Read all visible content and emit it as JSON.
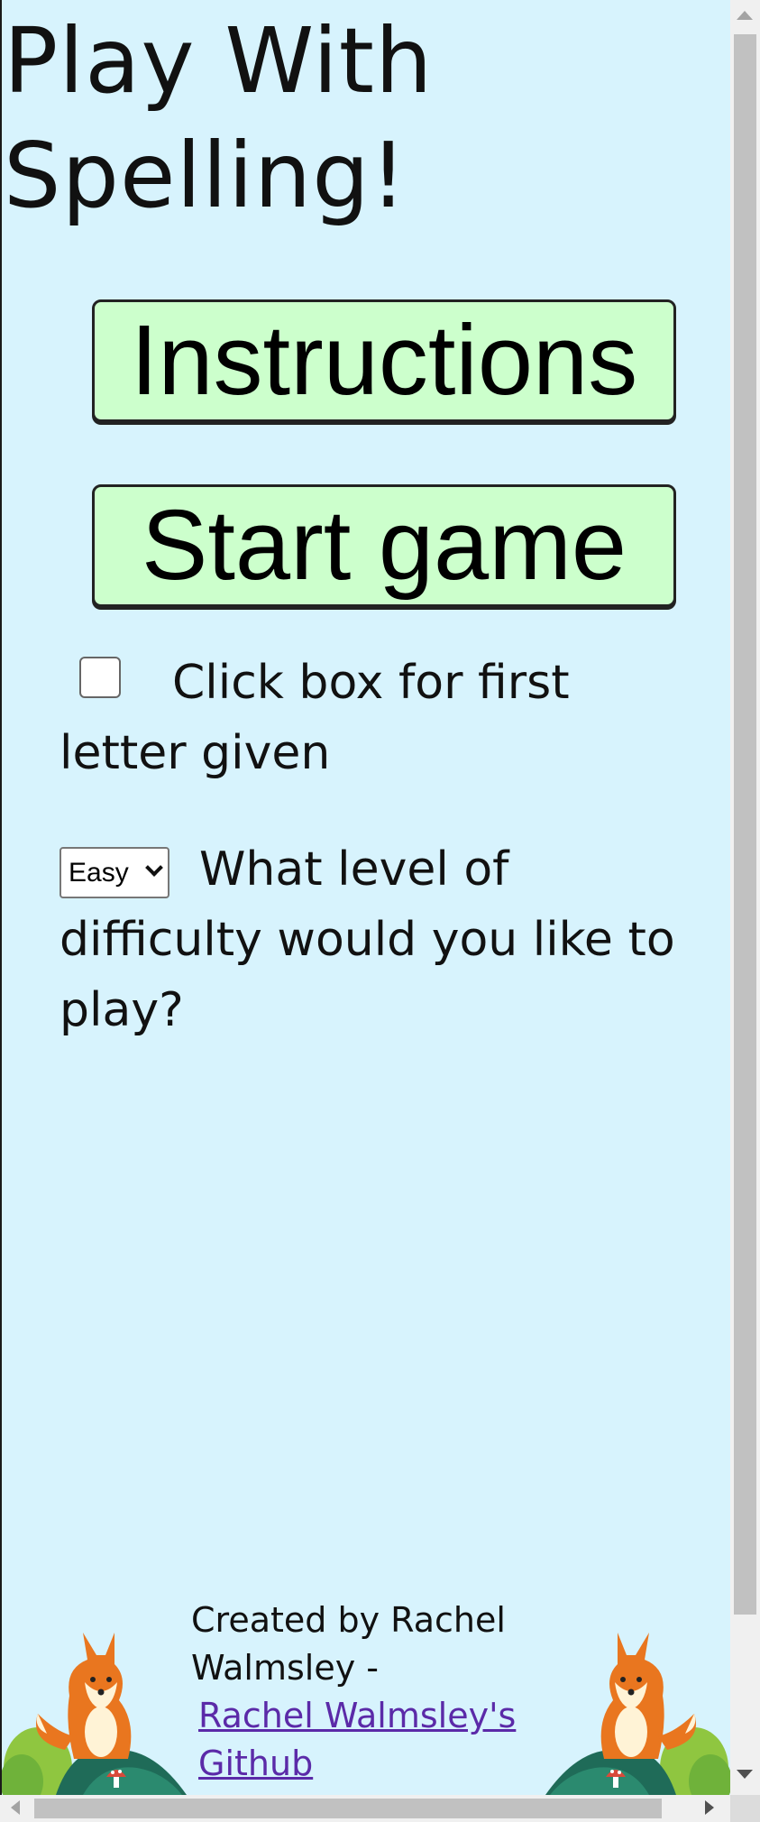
{
  "page": {
    "title": "Play With Spelling!",
    "background_color": "#d7f3fd",
    "button_color": "#ccffcc",
    "link_color": "#5b2aa8"
  },
  "buttons": {
    "instructions_label": "Instructions",
    "start_label": "Start game"
  },
  "options": {
    "first_letter_label": "Click box for first letter given",
    "first_letter_checked": false,
    "difficulty_selected": "Easy",
    "difficulty_label": "What level of difficulty would you like to play?"
  },
  "footer": {
    "credit_text": "Created by Rachel Walmsley -",
    "link_text": "Rachel Walmsley's Github",
    "decor_icon": "fox-forest-icon"
  }
}
